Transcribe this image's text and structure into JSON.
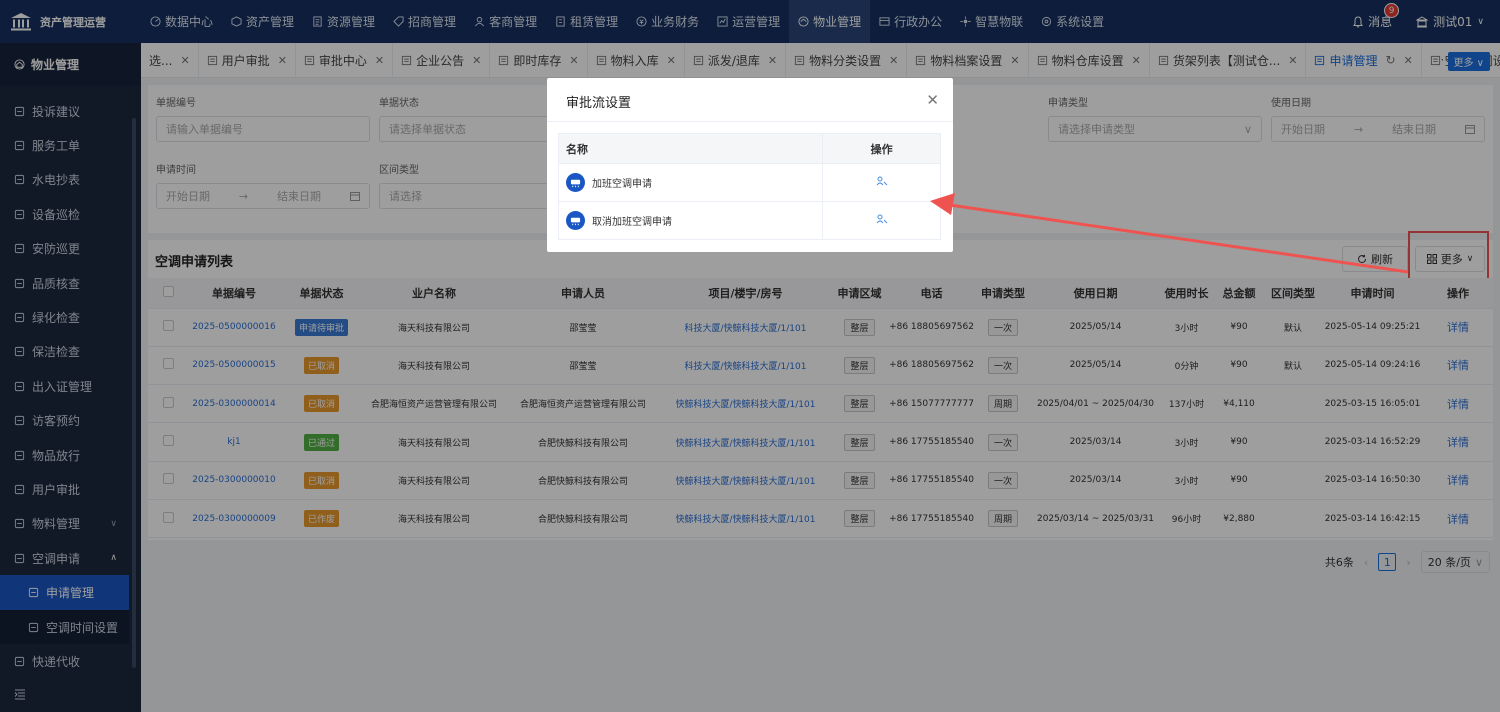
{
  "app": {
    "title": "资产管理运营"
  },
  "topnav": [
    {
      "label": "数据中心",
      "icon": "dashboard-icon"
    },
    {
      "label": "资产管理",
      "icon": "cube-icon"
    },
    {
      "label": "资源管理",
      "icon": "document-icon"
    },
    {
      "label": "招商管理",
      "icon": "tag-icon"
    },
    {
      "label": "客商管理",
      "icon": "users-icon"
    },
    {
      "label": "租赁管理",
      "icon": "building-icon"
    },
    {
      "label": "业务财务",
      "icon": "finance-icon"
    },
    {
      "label": "运营管理",
      "icon": "operation-icon"
    },
    {
      "label": "物业管理",
      "icon": "property-icon",
      "active": true
    },
    {
      "label": "行政办公",
      "icon": "office-icon"
    },
    {
      "label": "智慧物联",
      "icon": "iot-icon"
    },
    {
      "label": "系统设置",
      "icon": "settings-icon"
    }
  ],
  "header": {
    "message_label": "消息",
    "message_count": "9",
    "user_name": "测试01"
  },
  "sidebar": {
    "title": "物业管理",
    "items": [
      {
        "label": "投诉建议"
      },
      {
        "label": "服务工单"
      },
      {
        "label": "水电抄表"
      },
      {
        "label": "设备巡检"
      },
      {
        "label": "安防巡更"
      },
      {
        "label": "品质核查"
      },
      {
        "label": "绿化检查"
      },
      {
        "label": "保洁检查"
      },
      {
        "label": "出入证管理"
      },
      {
        "label": "访客预约"
      },
      {
        "label": "物品放行"
      },
      {
        "label": "用户审批"
      },
      {
        "label": "物料管理"
      },
      {
        "label": "空调申请"
      },
      {
        "label": "申请管理"
      },
      {
        "label": "空调时间设置"
      },
      {
        "label": "快递代收"
      }
    ]
  },
  "tabs": [
    {
      "label": "选..."
    },
    {
      "label": "用户审批"
    },
    {
      "label": "审批中心"
    },
    {
      "label": "企业公告"
    },
    {
      "label": "即时库存"
    },
    {
      "label": "物料入库"
    },
    {
      "label": "派发/退库"
    },
    {
      "label": "物料分类设置"
    },
    {
      "label": "物料档案设置"
    },
    {
      "label": "物料仓库设置"
    },
    {
      "label": "货架列表【测试仓..."
    },
    {
      "label": "申请管理"
    },
    {
      "label": "空调时间设置"
    }
  ],
  "tabs_more": "更多",
  "filters": {
    "doc_no": {
      "label": "单据编号",
      "placeholder": "请输入单据编号"
    },
    "doc_status": {
      "label": "单据状态",
      "placeholder": "请选择单据状态"
    },
    "apply_type": {
      "label": "申请类型",
      "placeholder": "请选择申请类型"
    },
    "use_date": {
      "label": "使用日期",
      "start": "开始日期",
      "sep": "→",
      "end": "结束日期"
    },
    "apply_time": {
      "label": "申请时间",
      "start": "开始日期",
      "sep": "→",
      "end": "结束日期"
    },
    "range_type": {
      "label": "区间类型",
      "placeholder": "请选择"
    }
  },
  "list": {
    "title": "空调申请列表",
    "refresh": "刷新",
    "more": "更多",
    "columns": [
      "单据编号",
      "单据状态",
      "业户名称",
      "申请人员",
      "项目/楼宇/房号",
      "申请区域",
      "电话",
      "申请类型",
      "使用日期",
      "使用时长",
      "总金额",
      "区间类型",
      "申请时间",
      "操作"
    ],
    "rows": [
      {
        "no": "2025-0500000016",
        "status": "申请待审批",
        "status_color": "#3a7bd5",
        "tenant": "海天科技有限公司",
        "applicant": "邵莹莹",
        "project": "科技大厦/快鲸科技大厦/1/101",
        "area": "整层",
        "phone": "+86 18805697562",
        "type": "一次",
        "date": "2025/05/14",
        "duration": "3小时",
        "amount": "¥90",
        "range": "默认",
        "time": "2025-05-14 09:25:21",
        "op": "详情"
      },
      {
        "no": "2025-0500000015",
        "status": "已取消",
        "status_color": "#e89a2c",
        "tenant": "海天科技有限公司",
        "applicant": "邵莹莹",
        "project": "科技大厦/快鲸科技大厦/1/101",
        "area": "整层",
        "phone": "+86 18805697562",
        "type": "一次",
        "date": "2025/05/14",
        "duration": "0分钟",
        "amount": "¥90",
        "range": "默认",
        "time": "2025-05-14 09:24:16",
        "op": "详情"
      },
      {
        "no": "2025-0300000014",
        "status": "已取消",
        "status_color": "#e89a2c",
        "tenant": "合肥海恒资产运营管理有限公司",
        "applicant": "合肥海恒资产运营管理有限公司",
        "project": "快鲸科技大厦/快鲸科技大厦/1/101",
        "area": "整层",
        "phone": "+86 15077777777",
        "type": "周期",
        "date": "2025/04/01 ~ 2025/04/30",
        "duration": "137小时",
        "amount": "¥4,110",
        "range": "",
        "time": "2025-03-15 16:05:01",
        "op": "详情"
      },
      {
        "no": "kj1",
        "status": "已通过",
        "status_color": "#52b143",
        "tenant": "海天科技有限公司",
        "applicant": "合肥快鲸科技有限公司",
        "project": "快鲸科技大厦/快鲸科技大厦/1/101",
        "area": "整层",
        "phone": "+86 17755185540",
        "type": "一次",
        "date": "2025/03/14",
        "duration": "3小时",
        "amount": "¥90",
        "range": "",
        "time": "2025-03-14 16:52:29",
        "op": "详情"
      },
      {
        "no": "2025-0300000010",
        "status": "已取消",
        "status_color": "#e89a2c",
        "tenant": "海天科技有限公司",
        "applicant": "合肥快鲸科技有限公司",
        "project": "快鲸科技大厦/快鲸科技大厦/1/101",
        "area": "整层",
        "phone": "+86 17755185540",
        "type": "一次",
        "date": "2025/03/14",
        "duration": "3小时",
        "amount": "¥90",
        "range": "",
        "time": "2025-03-14 16:50:30",
        "op": "详情"
      },
      {
        "no": "2025-0300000009",
        "status": "已作废",
        "status_color": "#e89a2c",
        "tenant": "海天科技有限公司",
        "applicant": "合肥快鲸科技有限公司",
        "project": "快鲸科技大厦/快鲸科技大厦/1/101",
        "area": "整层",
        "phone": "+86 17755185540",
        "type": "周期",
        "date": "2025/03/14 ~ 2025/03/31",
        "duration": "96小时",
        "amount": "¥2,880",
        "range": "",
        "time": "2025-03-14 16:42:15",
        "op": "详情"
      }
    ]
  },
  "pagination": {
    "total": "共6条",
    "current": "1",
    "page_size": "20 条/页"
  },
  "modal": {
    "title": "审批流设置",
    "col_name": "名称",
    "col_op": "操作",
    "rows": [
      {
        "name": "加班空调申请"
      },
      {
        "name": "取消加班空调申请"
      }
    ]
  },
  "colors": {
    "topbar": "#16305f",
    "sidebar": "#1c2940",
    "accent": "#1b6fe0",
    "annotation": "#ef5350"
  }
}
